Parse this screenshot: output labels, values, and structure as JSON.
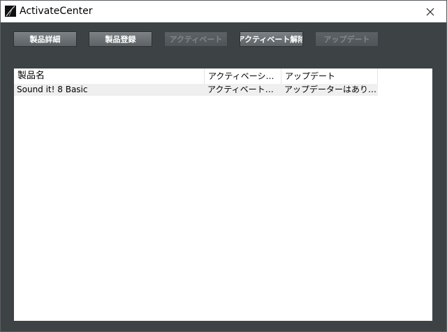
{
  "window": {
    "title": "ActivateCenter"
  },
  "toolbar": {
    "buttons": [
      {
        "label": "製品詳細",
        "enabled": true
      },
      {
        "label": "製品登録",
        "enabled": true
      },
      {
        "label": "アクティベート",
        "enabled": false
      },
      {
        "label": "アクティベート解除",
        "enabled": true
      },
      {
        "label": "アップデート",
        "enabled": false
      }
    ]
  },
  "list": {
    "columns": [
      "製品名",
      "アクティベーション...",
      "アップデート"
    ],
    "rows": [
      [
        "Sound it! 8 Basic",
        "アクティベート済み",
        "アップデーターはありま..."
      ]
    ]
  },
  "colors": {
    "background": "#3d4345",
    "button_enabled": "#6d7376",
    "button_disabled_text": "#80878a"
  }
}
